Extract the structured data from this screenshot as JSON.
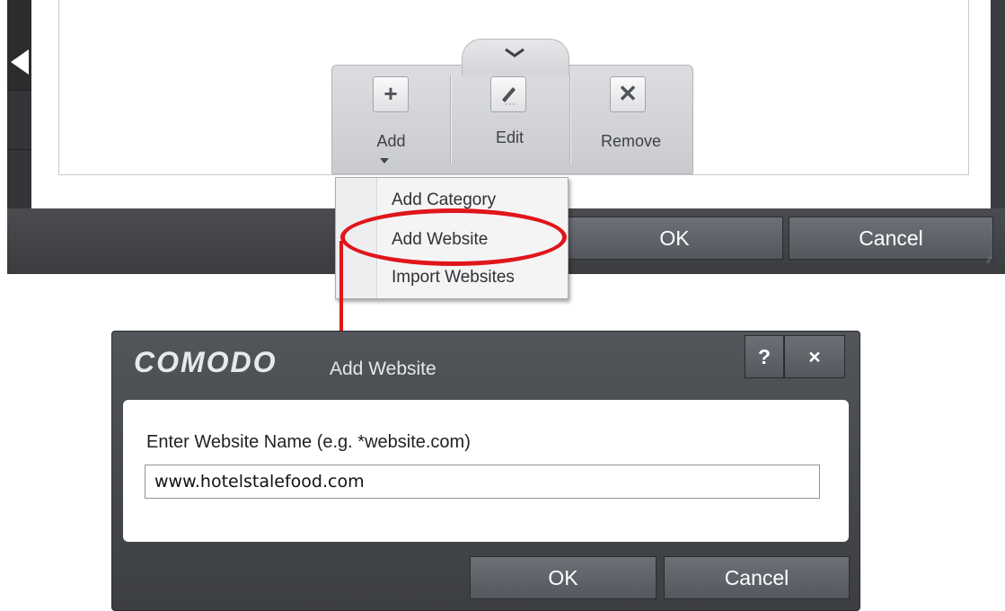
{
  "background_window": {
    "ok_label": "OK",
    "cancel_label": "Cancel"
  },
  "toolbar": {
    "add_label": "Add",
    "edit_label": "Edit",
    "remove_label": "Remove"
  },
  "dropdown": {
    "items": [
      {
        "label": "Add Category"
      },
      {
        "label": "Add Website"
      },
      {
        "label": "Import Websites"
      }
    ],
    "highlighted_item": "Add Website"
  },
  "dialog": {
    "brand": "COMODO",
    "title": "Add Website",
    "help_label": "?",
    "close_label": "×",
    "prompt": "Enter Website Name (e.g. *website.com)",
    "input_value": "www.hotelstalefood.com",
    "ok_label": "OK",
    "cancel_label": "Cancel"
  },
  "colors": {
    "callout": "#e0161b",
    "window_dark": "#3b3d40"
  },
  "icons": {
    "toolbar_chevron": "chevron-down-icon",
    "add": "plus-icon",
    "edit": "pencil-icon",
    "remove": "x-icon"
  }
}
